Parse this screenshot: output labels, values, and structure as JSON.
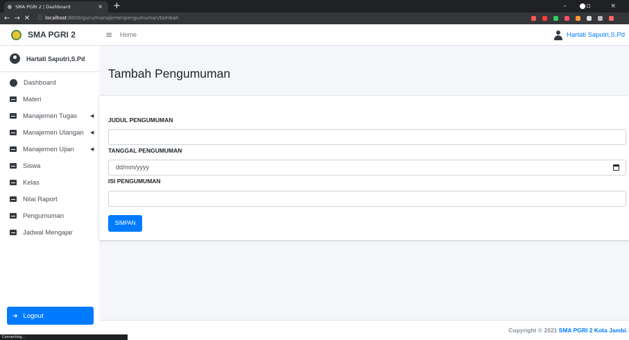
{
  "browser": {
    "tab_title": "SMA PGRI 2 | Dashboard",
    "tab_close": "×",
    "new_tab": "+",
    "window_controls": "– ▫ ×",
    "url_host": "localhost",
    "url_path": ":8000/guru/manajemenpengumuman/tambah",
    "status_text": "Connecting..."
  },
  "sidebar": {
    "brand": "SMA PGRI 2",
    "user": "Hartati Saputri,S.Pd",
    "items": [
      {
        "label": "Dashboard",
        "icon": "dashboard-icon"
      },
      {
        "label": "Materi",
        "icon": "book-icon"
      },
      {
        "label": "Manajemen Tugas",
        "icon": "book-icon",
        "chevron": "◀"
      },
      {
        "label": "Manajemen Ulangan",
        "icon": "book-icon",
        "chevron": "◀"
      },
      {
        "label": "Manajemen Ujian",
        "icon": "book-icon",
        "chevron": "◀"
      },
      {
        "label": "Siswa",
        "icon": "book-icon"
      },
      {
        "label": "Kelas",
        "icon": "book-icon"
      },
      {
        "label": "Nilai Raport",
        "icon": "book-icon"
      },
      {
        "label": "Pengumuman",
        "icon": "book-icon"
      },
      {
        "label": "Jadwal Mengajar",
        "icon": "book-icon"
      }
    ],
    "logout": "Logout"
  },
  "topnav": {
    "home": "Home",
    "user": "Hartati Saputri,S.Pd"
  },
  "page": {
    "title": "Tambah Pengumuman"
  },
  "form": {
    "judul_label": "JUDUL PENGUMUMAN",
    "judul_value": "",
    "tanggal_label": "TANGGAL PENGUMUMAN",
    "tanggal_placeholder": "dd/mm/yyyy",
    "isi_label": "ISI PENGUMUMAN",
    "isi_value": "",
    "submit": "SIMPAN"
  },
  "footer": {
    "prefix": "Copyright © 2021 ",
    "link": "SMA PGRI 2 Kota Jambi."
  },
  "colors": {
    "primary": "#007bff",
    "sidebar_bg": "#ffffff",
    "content_bg": "#f4f6f9",
    "chrome_dark": "#202124"
  }
}
